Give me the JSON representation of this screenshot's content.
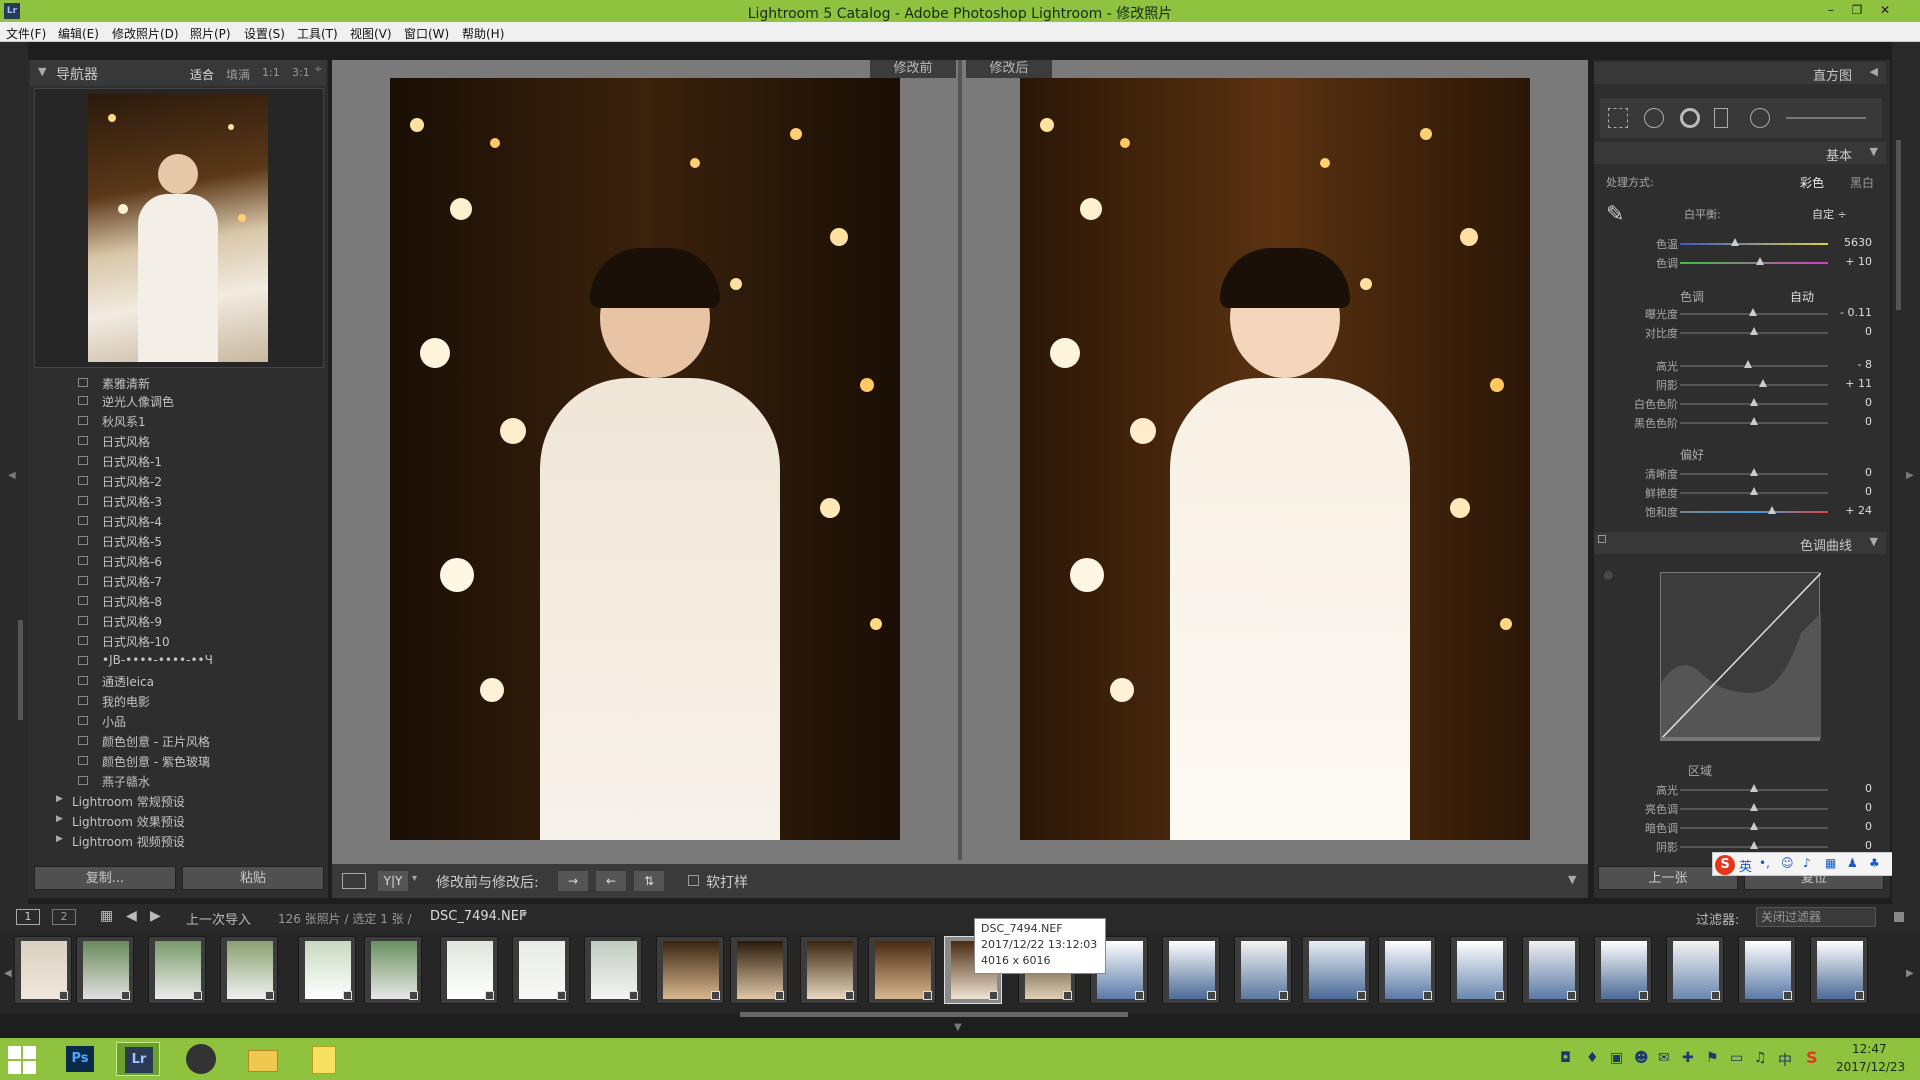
{
  "window": {
    "title": "Lightroom 5 Catalog - Adobe Photoshop Lightroom - 修改照片",
    "app_icon": "Lr"
  },
  "menu": [
    "文件(F)",
    "编辑(E)",
    "修改照片(D)",
    "照片(P)",
    "设置(S)",
    "工具(T)",
    "视图(V)",
    "窗口(W)",
    "帮助(H)"
  ],
  "navigator": {
    "title": "导航器",
    "zoom_options": [
      "适合",
      "填满",
      "1:1",
      "3:1"
    ]
  },
  "presets": {
    "partial_top": "素雅清新",
    "items": [
      "逆光人像调色",
      "秋风系1",
      "日式风格",
      "日式风格-1",
      "日式风格-2",
      "日式风格-3",
      "日式风格-4",
      "日式风格-5",
      "日式风格-6",
      "日式风格-7",
      "日式风格-8",
      "日式风格-9",
      "日式风格-10",
      "•JB-••••-••••-••Ч",
      "通透leica",
      "我的电影",
      "小品",
      "颜色创意 - 正片风格",
      "颜色创意 - 紫色玻璃",
      "燕子赣水"
    ],
    "groups": [
      "Lightroom 常规预设",
      "Lightroom 效果预设",
      "Lightroom 视频预设"
    ],
    "copy_button": "复制...",
    "paste_button": "粘贴"
  },
  "compare": {
    "before_label": "修改前",
    "after_label": "修改后"
  },
  "toolbar": {
    "view_mode": "Y|Y",
    "before_after_label": "修改前与修改后:",
    "soft_proof": "软打样"
  },
  "right_panel": {
    "histogram": "直方图",
    "basic": "基本",
    "treatment_label": "处理方式:",
    "treatment_color": "彩色",
    "treatment_bw": "黑白",
    "wb_label": "白平衡:",
    "wb_value": "自定 ÷",
    "tone_label": "色调",
    "tone_auto": "自动",
    "presence_label": "偏好",
    "tone_curve": "色调曲线",
    "region_label": "区域",
    "prev_button": "上一张",
    "reset_button": "复位",
    "sliders_wb": [
      {
        "label": "色温",
        "value": "5630",
        "pos": 0.37
      },
      {
        "label": "色调",
        "value": "+ 10",
        "pos": 0.54
      }
    ],
    "sliders_tone": [
      {
        "label": "曝光度",
        "value": "- 0.11",
        "pos": 0.49
      },
      {
        "label": "对比度",
        "value": "0",
        "pos": 0.5
      }
    ],
    "sliders_tone2": [
      {
        "label": "高光",
        "value": "- 8",
        "pos": 0.46
      },
      {
        "label": "阴影",
        "value": "+ 11",
        "pos": 0.56
      },
      {
        "label": "白色色阶",
        "value": "0",
        "pos": 0.5
      },
      {
        "label": "黑色色阶",
        "value": "0",
        "pos": 0.5
      }
    ],
    "sliders_presence": [
      {
        "label": "清晰度",
        "value": "0",
        "pos": 0.5
      },
      {
        "label": "鲜艳度",
        "value": "0",
        "pos": 0.5
      },
      {
        "label": "饱和度",
        "value": "+ 24",
        "pos": 0.62
      }
    ],
    "sliders_region": [
      {
        "label": "高光",
        "value": "0",
        "pos": 0.5
      },
      {
        "label": "亮色调",
        "value": "0",
        "pos": 0.5
      },
      {
        "label": "暗色调",
        "value": "0",
        "pos": 0.5
      },
      {
        "label": "阴影",
        "value": "0",
        "pos": 0.5
      }
    ]
  },
  "filmbar": {
    "page1": "1",
    "page2": "2",
    "source": "上一次导入",
    "count": "126 张照片 / 选定 1 张 /",
    "filename": "DSC_7494.NEF",
    "filter_label": "过滤器:",
    "filter_value": "关闭过滤器"
  },
  "tooltip": {
    "name": "DSC_7494.NEF",
    "date": "2017/12/22 13:12:03",
    "size": "4016 x 6016"
  },
  "ime": {
    "mode": "英"
  },
  "taskbar": {
    "apps": [
      "Ps",
      "Lr"
    ],
    "time": "12:47",
    "date": "2017/12/23"
  }
}
